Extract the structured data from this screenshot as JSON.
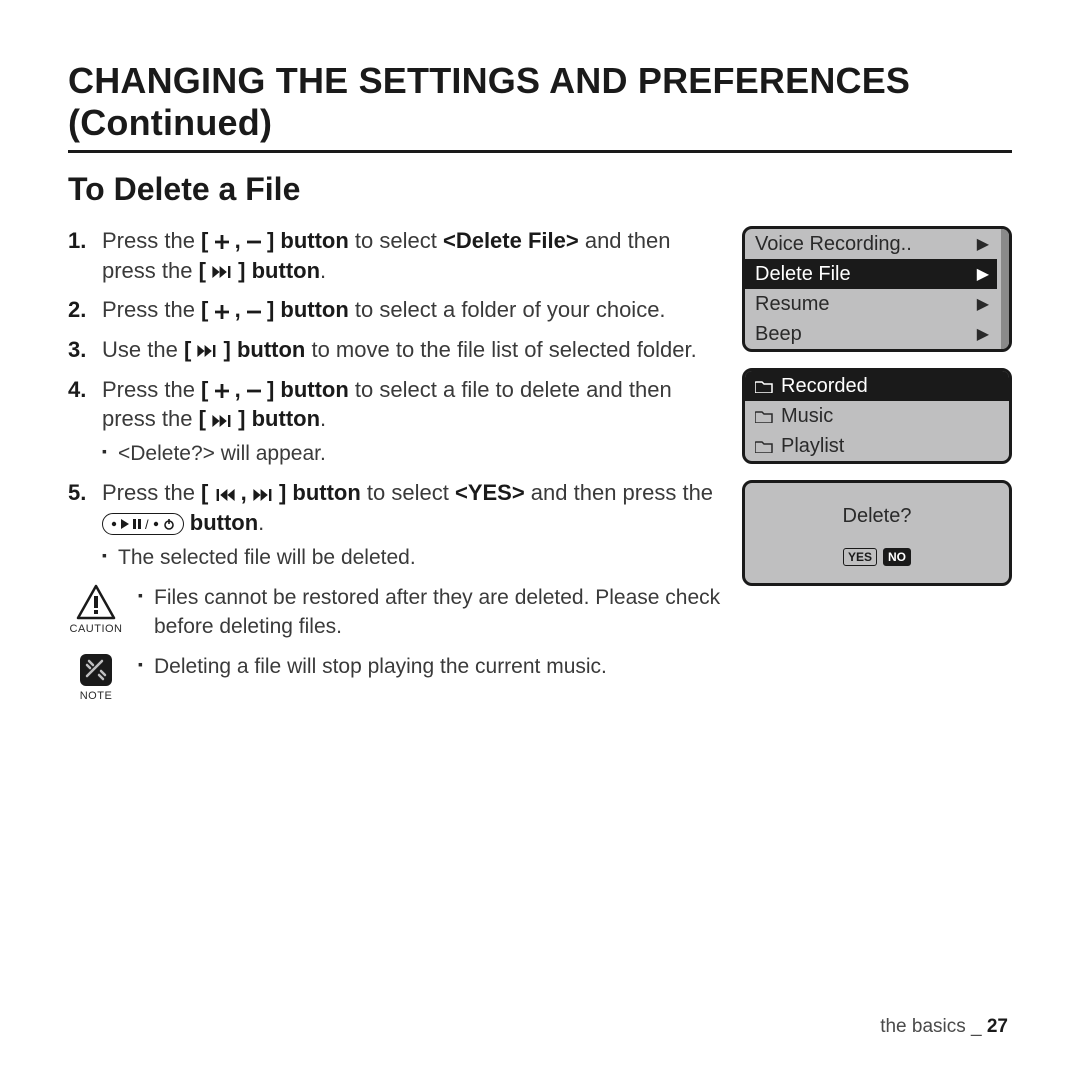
{
  "heading": "CHANGING THE SETTINGS AND PREFERENCES (Continued)",
  "subheading": "To Delete a File",
  "steps": {
    "s1a": "Press the ",
    "s1btn": "[       ,       ] button",
    "s1b": " to select ",
    "s1c": "<Delete File>",
    "s1d": " and then press the ",
    "s1e": "[       ] button",
    "s1f": ".",
    "s2a": "Press the ",
    "s2btn": "[       ,       ] button",
    "s2b": " to select a folder of your choice.",
    "s3a": "Use the ",
    "s3btn": "[       ] button",
    "s3b": " to move to the file list of selected folder.",
    "s4a": "Press the ",
    "s4btn": "[       ,       ] button",
    "s4b": " to select a file to delete and then press the ",
    "s4btn2": "[       ] button",
    "s4c": ".",
    "s4sub": "<Delete?> will appear.",
    "s5a": "Press the ",
    "s5btn": "[       ,       ] button",
    "s5b": " to select ",
    "s5yes": "<YES>",
    "s5c": " and then press the ",
    "s5d": "  button",
    "s5e": ".",
    "s5sub": "The selected file will be deleted."
  },
  "menu": {
    "items": [
      "Voice Recording..",
      "Delete File",
      "Resume",
      "Beep"
    ],
    "selectedIndex": 1
  },
  "folders": {
    "items": [
      "Recorded",
      "Music",
      "Playlist"
    ],
    "selectedIndex": 0
  },
  "dialog": {
    "question": "Delete?",
    "yes": "YES",
    "no": "NO"
  },
  "caution": {
    "label": "CAUTION",
    "text": "Files cannot be restored after they are deleted. Please check before deleting files."
  },
  "note": {
    "label": "NOTE",
    "text": "Deleting a file will stop playing the current music."
  },
  "footer": {
    "section": "the basics _ ",
    "page": "27"
  }
}
